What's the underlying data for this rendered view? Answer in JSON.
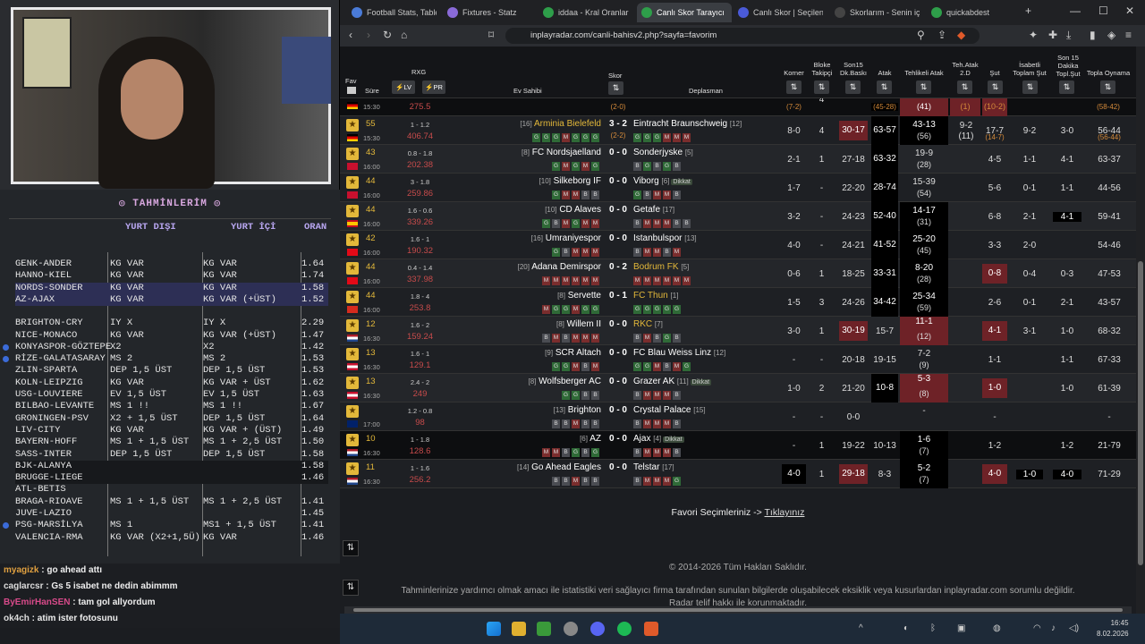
{
  "predictions": {
    "title": "TAHMİNLERİM",
    "header_dis": "YURT DIŞI",
    "header_ic": "YURT İÇİ",
    "header_oran": "ORAN",
    "rows": [
      {
        "match": "GENK-ANDER",
        "dis": "KG VAR",
        "ic": "KG VAR",
        "oran": "1.64"
      },
      {
        "match": "HANNO-KIEL",
        "dis": "KG VAR",
        "ic": "KG VAR",
        "oran": "1.74"
      },
      {
        "match": "NORDS-SONDER",
        "dis": "KG VAR",
        "ic": "KG VAR",
        "oran": "1.58"
      },
      {
        "match": "AZ-AJAX",
        "dis": "KG VAR",
        "ic": "KG VAR (+ÜST)",
        "oran": "1.52"
      },
      {
        "match": "BRIGHTON-CRY",
        "dis": "IY X",
        "ic": "IY X",
        "oran": "2.29"
      },
      {
        "match": "NICE-MONACO",
        "dis": "KG VAR",
        "ic": "KG VAR (+ÜST)",
        "oran": "1.47"
      },
      {
        "match": "KONYASPOR-GÖZTEPE",
        "dis": "X2",
        "ic": "X2",
        "oran": "1.42"
      },
      {
        "match": "RİZE-GALATASARAY",
        "dis": "MS 2",
        "ic": "MS 2",
        "oran": "1.53"
      },
      {
        "match": "ZLIN-SPARTA",
        "dis": "DEP 1,5 ÜST",
        "ic": "DEP 1,5 ÜST",
        "oran": "1.53"
      },
      {
        "match": "KOLN-LEIPZIG",
        "dis": "KG VAR",
        "ic": "KG VAR + ÜST",
        "oran": "1.62"
      },
      {
        "match": "USG-LOUVIERE",
        "dis": "EV 1,5 ÜST",
        "ic": "EV 1,5 ÜST",
        "oran": "1.63"
      },
      {
        "match": "BILBAO-LEVANTE",
        "dis": "MS 1 !!",
        "ic": "MS 1 !!",
        "oran": "1.67"
      },
      {
        "match": "GRONINGEN-PSV",
        "dis": "X2 + 1,5 ÜST",
        "ic": "DEP 1,5 ÜST",
        "oran": "1.64"
      },
      {
        "match": "LIV-CITY",
        "dis": "KG VAR",
        "ic": "KG VAR + (ÜST)",
        "oran": "1.49"
      },
      {
        "match": "BAYERN-HOFF",
        "dis": "MS 1 + 1,5 ÜST",
        "ic": "MS 1 + 2,5 ÜST",
        "oran": "1.50"
      },
      {
        "match": "SASS-INTER",
        "dis": "DEP 1,5 ÜST",
        "ic": "DEP 1,5 ÜST",
        "oran": "1.58"
      },
      {
        "match": "BJK-ALANYA",
        "dis": "",
        "ic": "",
        "oran": "1.58"
      },
      {
        "match": "BRUGGE-LIEGE",
        "dis": "",
        "ic": "",
        "oran": "1.46"
      },
      {
        "match": "ATL-BETIS",
        "dis": "",
        "ic": "",
        "oran": ""
      },
      {
        "match": "BRAGA-RIOAVE",
        "dis": "MS 1 + 1,5 ÜST",
        "ic": "MS 1 + 2,5 ÜST",
        "oran": "1.41"
      },
      {
        "match": "JUVE-LAZIO",
        "dis": "",
        "ic": "",
        "oran": "1.45"
      },
      {
        "match": "PSG-MARSİLYA",
        "dis": "MS 1",
        "ic": "MS1 + 1,5 ÜST",
        "oran": "1.41"
      },
      {
        "match": "VALENCIA-RMA",
        "dis": "KG VAR (X2+1,5Ü)",
        "ic": "KG VAR",
        "oran": "1.46"
      }
    ]
  },
  "chat": [
    {
      "user": "myagizk",
      "msg": "go ahead attı"
    },
    {
      "user": "caglarcsr",
      "msg": "Gs 5 isabet ne dedin abimmm"
    },
    {
      "user": "ByEmirHanSEN",
      "msg": "tam gol allyordum"
    },
    {
      "user": "ok4ch",
      "msg": "atim ister fotosunu"
    }
  ],
  "tabs": [
    {
      "label": "Football Stats, Tables",
      "color": "#4a7bd8"
    },
    {
      "label": "Fixtures - Statz",
      "color": "#8a6ad8"
    },
    {
      "label": "iddaa - Kral Oranlar",
      "color": "#2e9e4a"
    },
    {
      "label": "Canlı Skor Tarayıcı",
      "color": "#2e9e4a"
    },
    {
      "label": "Canlı Skor | Seçilen maçlar",
      "color": "#4a5ad8"
    },
    {
      "label": "Skorlarım - Senin için",
      "color": "#444"
    },
    {
      "label": "quickabdest",
      "color": "#2e9e4a"
    }
  ],
  "address": {
    "url": "inplayradar.com/canli-bahisv2.php?sayfa=favorim"
  },
  "table_header": {
    "fav": "Fav",
    "sure": "Süre",
    "rxg": "RXG",
    "lv": "⚡LV",
    "pr": "⚡PR",
    "skor": "Skor",
    "ev": "Ev Sahibi",
    "dep": "Deplasman",
    "korner": "Korner",
    "bloke": "Bloke Takipçi",
    "son15": "Son15 Dk.Baskı",
    "atak": "Atak",
    "tatak": "Tehlikeli Atak",
    "teh2": "Teh.Atak 2.D",
    "sut": "Şut",
    "isabetli": "İsabetli Toplam Şut",
    "son15sut": "Son 15 Dakika Topl.Şut",
    "topla": "Topla Oynama"
  },
  "partial_row": {
    "rxg": "275.5",
    "subscore": "(2-0)",
    "korner": "(7-2)",
    "bloke": "4",
    "atak": "(45-28)",
    "tatak": "(41)",
    "teh2": "(1)",
    "sut": "(10-2)",
    "topla": "(58-42)"
  },
  "matches": [
    {
      "min": "55",
      "time": "15:30",
      "rxg": "1 - 1.2",
      "rxgv": "406.74",
      "home": "Arminia Bielefeld",
      "hrank": "[16]",
      "score": "3 - 2",
      "sub": "(2-2)",
      "away": "Eintracht Braunschweig",
      "arank": "[12]",
      "kor": "8-0",
      "kor2": "(5-0)",
      "blk": "4",
      "s15": "30-17",
      "atak": "63-57",
      "atak2": "(51-50)",
      "ta": "43-13",
      "ta2": "(34-11:45)",
      "ta3": "(56)",
      "t2": "9-2",
      "t22": "(11)",
      "sut": "17-7",
      "sut2": "(14-7)",
      "is": "9-2",
      "s15s": "3-0",
      "top": "56-44",
      "top2": "(56-44)"
    },
    {
      "min": "43",
      "time": "16:00",
      "rxg": "0.8 - 1.8",
      "rxgv": "202.38",
      "home": "FC Nordsjaelland",
      "hrank": "[8]",
      "score": "0 - 0",
      "away": "Sonderjyske",
      "arank": "[5]",
      "kor": "2-1",
      "blk": "1",
      "s15": "27-18",
      "atak": "63-32",
      "ta": "19-9",
      "ta3": "(28)",
      "sut": "4-5",
      "is": "1-1",
      "s15s": "4-1",
      "top": "63-37"
    },
    {
      "min": "44",
      "time": "16:00",
      "rxg": "3 - 1.8",
      "rxgv": "259.86",
      "home": "Silkeborg IF",
      "hrank": "[10]",
      "score": "0 - 0",
      "away": "Viborg",
      "arank": "[6]",
      "kor": "1-7",
      "blk": "-",
      "s15": "22-20",
      "atak": "28-74",
      "ta": "15-39",
      "ta3": "(54)",
      "sut": "5-6",
      "is": "0-1",
      "s15s": "1-1",
      "top": "44-56"
    },
    {
      "min": "44",
      "time": "16:00",
      "rxg": "1.6 - 0.6",
      "rxgv": "339.26",
      "home": "CD Alaves",
      "hrank": "[10]",
      "score": "0 - 0",
      "away": "Getafe",
      "arank": "[17]",
      "kor": "3-2",
      "blk": "-",
      "s15": "24-23",
      "atak": "52-40",
      "ta": "14-17",
      "ta3": "(31)",
      "sut": "6-8",
      "is": "2-1",
      "s15s": "4-1",
      "top": "59-41"
    },
    {
      "min": "42",
      "time": "16:00",
      "rxg": "1.6 - 1",
      "rxgv": "190.32",
      "home": "Umraniyespor",
      "hrank": "[16]",
      "score": "0 - 0",
      "away": "Istanbulspor",
      "arank": "[13]",
      "kor": "4-0",
      "blk": "-",
      "s15": "24-21",
      "atak": "41-52",
      "ta": "25-20",
      "ta3": "(45)",
      "sut": "3-3",
      "is": "2-0",
      "s15s": "",
      "top": "54-46"
    },
    {
      "min": "44",
      "time": "16:00",
      "rxg": "0.4 - 1.4",
      "rxgv": "337.98",
      "home": "Adana Demirspor",
      "hrank": "[20]",
      "score": "0 - 2",
      "away": "Bodrum FK",
      "arank": "[5]",
      "kor": "0-6",
      "blk": "1",
      "s15": "18-25",
      "atak": "33-31",
      "ta": "8-20",
      "ta3": "(28)",
      "sut": "0-8",
      "is": "0-4",
      "s15s": "0-3",
      "top": "47-53"
    },
    {
      "min": "44",
      "time": "16:00",
      "rxg": "1.8 - 4",
      "rxgv": "253.8",
      "home": "Servette",
      "hrank": "[8]",
      "score": "0 - 1",
      "away": "FC Thun",
      "arank": "[1]",
      "kor": "1-5",
      "blk": "3",
      "s15": "24-26",
      "atak": "34-42",
      "ta": "25-34",
      "ta3": "(59)",
      "sut": "2-6",
      "is": "0-1",
      "s15s": "2-1",
      "top": "43-57"
    },
    {
      "min": "12",
      "time": "16:30",
      "rxg": "1.6 - 2",
      "rxgv": "159.24",
      "home": "Willem II",
      "hrank": "[8]",
      "score": "0 - 0",
      "away": "RKC",
      "arank": "[7]",
      "kor": "3-0",
      "blk": "1",
      "s15": "30-19",
      "atak": "15-7",
      "ta": "11-1",
      "ta3": "(12)",
      "sut": "4-1",
      "is": "3-1",
      "s15s": "1-0",
      "top": "68-32"
    },
    {
      "min": "13",
      "time": "16:30",
      "rxg": "1.6 - 1",
      "rxgv": "129.1",
      "home": "SCR Altach",
      "hrank": "[9]",
      "score": "0 - 0",
      "away": "FC Blau Weiss Linz",
      "arank": "[12]",
      "kor": "-",
      "blk": "-",
      "s15": "20-18",
      "atak": "19-15",
      "ta": "7-2",
      "ta3": "(9)",
      "sut": "1-1",
      "is": "",
      "s15s": "1-1",
      "top": "67-33"
    },
    {
      "min": "13",
      "time": "16:30",
      "rxg": "2.4 - 2",
      "rxgv": "249",
      "home": "Wolfsberger AC",
      "hrank": "[8]",
      "score": "0 - 0",
      "away": "Grazer AK",
      "arank": "[11]",
      "kor": "1-0",
      "blk": "2",
      "s15": "21-20",
      "atak": "10-8",
      "ta": "5-3",
      "ta3": "(8)",
      "sut": "1-0",
      "is": "",
      "s15s": "1-0",
      "top": "61-39"
    },
    {
      "min": "",
      "time": "17:00",
      "rxg": "1.2 - 0.8",
      "rxgv": "98",
      "home": "Brighton",
      "hrank": "[13]",
      "score": "0 - 0",
      "away": "Crystal Palace",
      "arank": "[15]",
      "kor": "-",
      "blk": "-",
      "s15": "0-0",
      "atak": "",
      "ta": "-",
      "ta3": "",
      "sut": "-",
      "is": "",
      "s15s": "",
      "top": "-"
    },
    {
      "min": "10",
      "time": "16:30",
      "rxg": "1 - 1.8",
      "rxgv": "128.6",
      "home": "AZ",
      "hrank": "[6]",
      "score": "0 - 0",
      "away": "Ajax",
      "arank": "[4]",
      "kor": "-",
      "blk": "1",
      "s15": "19-22",
      "atak": "10-13",
      "ta": "1-6",
      "ta3": "(7)",
      "sut": "1-2",
      "is": "",
      "s15s": "1-2",
      "top": "21-79"
    },
    {
      "min": "11",
      "time": "16:30",
      "rxg": "1 - 1.6",
      "rxgv": "256.2",
      "home": "Go Ahead Eagles",
      "hrank": "[14]",
      "score": "0 - 0",
      "away": "Telstar",
      "arank": "[17]",
      "kor": "4-0",
      "blk": "1",
      "s15": "29-18",
      "atak": "8-3",
      "ta": "5-2",
      "ta3": "(7)",
      "sut": "4-0",
      "is": "1-0",
      "s15s": "4-0",
      "top": "71-29"
    }
  ],
  "footer": {
    "fav_text": "Favori Seçimleriniz ->",
    "fav_link": "Tıklayınız",
    "copyright": "© 2014-2026 Tüm Hakları Saklıdır.",
    "disclaimer": "Tahminlerinize yardımcı olmak amacı ile istatistiki veri sağlayıcı firma tarafından sunulan bilgilerde oluşabilecek eksiklik veya kusurlardan inplayradar.com sorumlu değildir.",
    "disclaimer2": "Radar telif hakkı ile korunmaktadır."
  },
  "badges": {
    "dikkat": "Dikkat",
    "io": "IO"
  },
  "clock": {
    "time": "16:45",
    "date": "8.02.2026"
  }
}
